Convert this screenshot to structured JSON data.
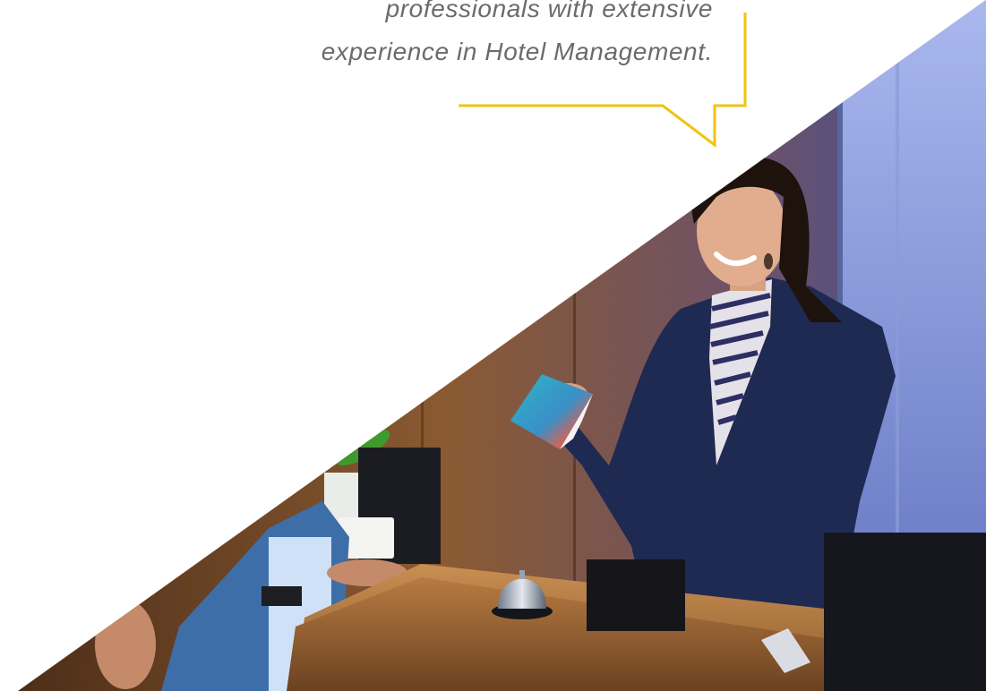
{
  "testimonial": {
    "line_1": "professionals with extensive",
    "line_2": "experience in Hotel Management."
  },
  "colors": {
    "background": "#ffffff",
    "quote_text": "#6b6b6b",
    "speech_bubble_accent": "#f2c311"
  },
  "image": {
    "subject": "hotel-reception-photo",
    "icon": "reception-bell-icon"
  }
}
